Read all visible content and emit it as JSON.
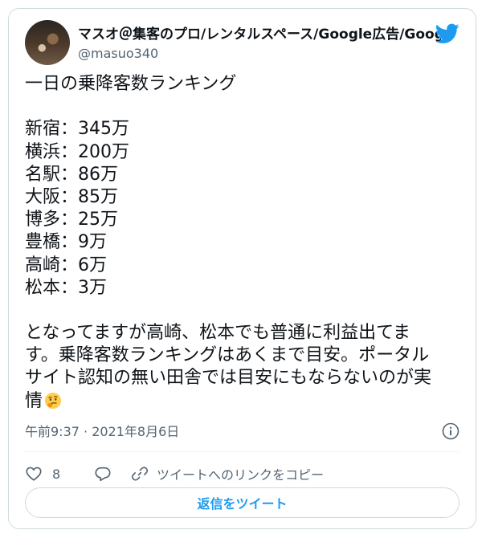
{
  "author": {
    "display_name": "マスオ＠集客のプロ/レンタルスペース/Google広告/Goog",
    "handle": "@masuo340",
    "avatar_icon": "profile-photo"
  },
  "brand": {
    "icon": "twitter-bird-icon",
    "color": "#1d9bf0"
  },
  "tweet": {
    "heading": "一日の乗降客数ランキング",
    "ranking": [
      "新宿：345万",
      "横浜：200万",
      "名駅：86万",
      "大阪：85万",
      "博多：25万",
      "豊橋：9万",
      "高崎：6万",
      "松本：3万"
    ],
    "paragraph_lines": [
      "となってますが高崎、松本でも普通に利益出てま",
      "す。乗降客数ランキングはあくまで目安。ポータル",
      "サイト認知の無い田舎では目安にもならないのが実",
      "情"
    ],
    "emoji": "thinking-face"
  },
  "meta": {
    "timestamp": "午前9:37 · 2021年8月6日"
  },
  "actions": {
    "like_count": "8",
    "copy_link_label": "ツイートへのリンクをコピー",
    "retweet_label": "返信をツイート"
  },
  "colors": {
    "text": "#0f1419",
    "secondary": "#536471",
    "border": "#cfd9de",
    "accent": "#1d9bf0"
  }
}
